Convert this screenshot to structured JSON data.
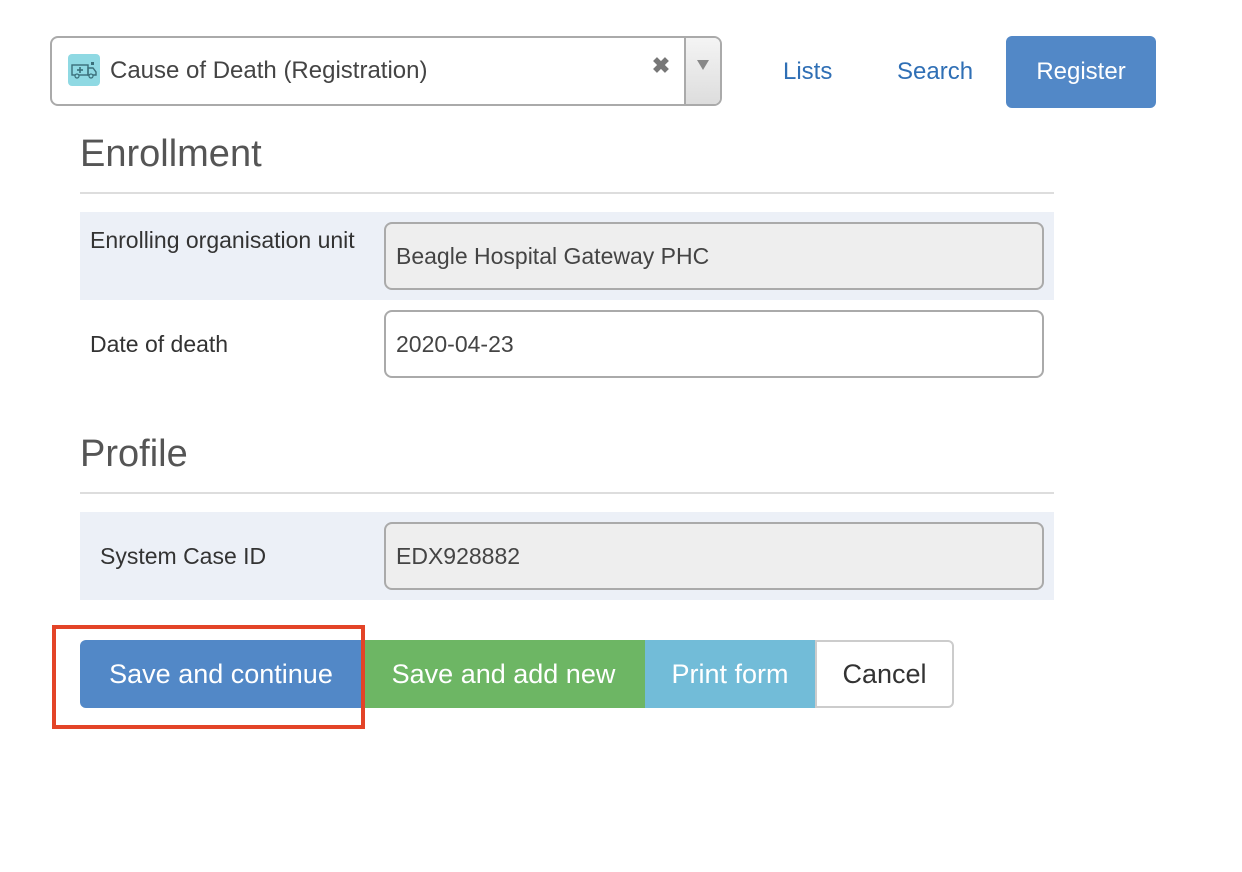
{
  "program_selector": {
    "program_name": "Cause of Death (Registration)",
    "icon": "ambulance-icon",
    "clear_symbol": "✖"
  },
  "nav": {
    "lists": "Lists",
    "search": "Search",
    "register": "Register"
  },
  "enrollment": {
    "title": "Enrollment",
    "org_unit_label": "Enrolling organisation unit",
    "org_unit_value": "Beagle Hospital Gateway PHC",
    "date_of_death_label": "Date of death",
    "date_of_death_value": "2020-04-23"
  },
  "profile": {
    "title": "Profile",
    "case_id_label": "System Case ID",
    "case_id_value": "EDX928882"
  },
  "actions": {
    "save_continue": "Save and continue",
    "save_add_new": "Save and add new",
    "print_form": "Print form",
    "cancel": "Cancel"
  },
  "colors": {
    "primary": "#5288c7",
    "success": "#6db664",
    "info": "#72bcd8",
    "highlight": "#e34427"
  }
}
